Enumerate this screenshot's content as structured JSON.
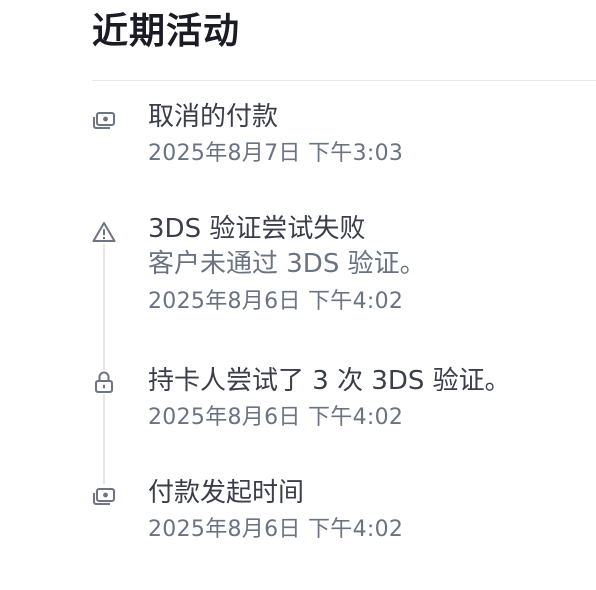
{
  "header": {
    "title": "近期活动"
  },
  "events": [
    {
      "icon": "payment-icon",
      "title": "取消的付款",
      "description": "",
      "time": "2025年8月7日 下午3:03"
    },
    {
      "icon": "warning-icon",
      "title": "3DS 验证尝试失败",
      "description": "客户未通过 3DS 验证。",
      "time": "2025年8月6日 下午4:02"
    },
    {
      "icon": "lock-icon",
      "title": "持卡人尝试了 3 次 3DS 验证。",
      "description": "",
      "time": "2025年8月6日 下午4:02"
    },
    {
      "icon": "payment-icon",
      "title": "付款发起时间",
      "description": "",
      "time": "2025年8月6日 下午4:02"
    }
  ],
  "colors": {
    "title": "#1a1b25",
    "text": "#3a3e4a",
    "muted": "#6a7383",
    "icon": "#6c7485",
    "divider": "#e6e8ec",
    "timeline": "#e3e6ea"
  }
}
